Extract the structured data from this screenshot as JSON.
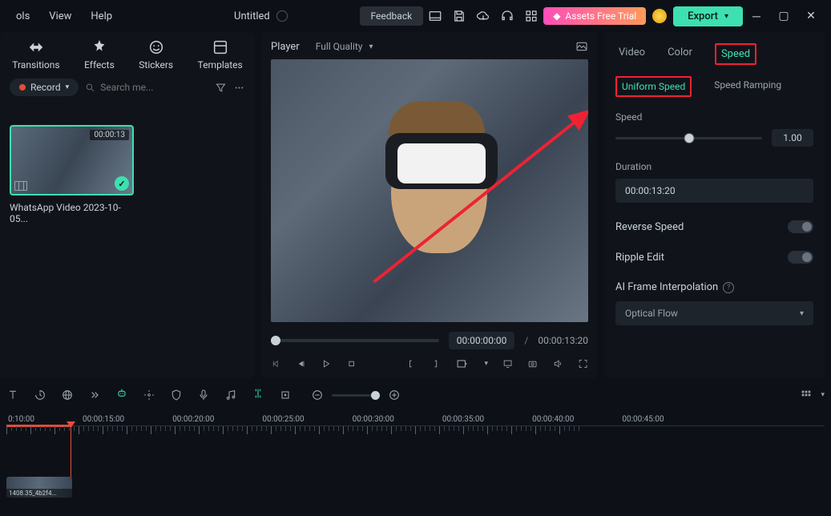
{
  "menu": {
    "ols": "ols",
    "view": "View",
    "help": "Help"
  },
  "doc": {
    "title": "Untitled"
  },
  "top": {
    "feedback": "Feedback",
    "assets": "Assets Free Trial",
    "export": "Export"
  },
  "leftTabs": {
    "transitions": "Transitions",
    "effects": "Effects",
    "stickers": "Stickers",
    "templates": "Templates"
  },
  "toolbar": {
    "record": "Record",
    "searchPlaceholder": "Search me..."
  },
  "clip": {
    "duration": "00:00:13",
    "name": "WhatsApp Video 2023-10-05..."
  },
  "preview": {
    "player": "Player",
    "quality": "Full Quality",
    "current": "00:00:00:00",
    "sep": "/",
    "total": "00:00:13:20"
  },
  "right": {
    "video": "Video",
    "color": "Color",
    "speed": "Speed",
    "uniform": "Uniform Speed",
    "ramping": "Speed Ramping",
    "speedLabel": "Speed",
    "speedValue": "1.00",
    "durationLabel": "Duration",
    "durationValue": "00:00:13:20",
    "reverse": "Reverse Speed",
    "ripple": "Ripple Edit",
    "ai": "AI Frame Interpolation",
    "optical": "Optical Flow"
  },
  "timeline": {
    "codes": [
      "0:10:00",
      "00:00:15:00",
      "00:00:20:00",
      "00:00:25:00",
      "00:00:30:00",
      "00:00:35:00",
      "00:00:40:00",
      "00:00:45:00"
    ],
    "clipLabel": "1408.35_4b2f4..."
  }
}
